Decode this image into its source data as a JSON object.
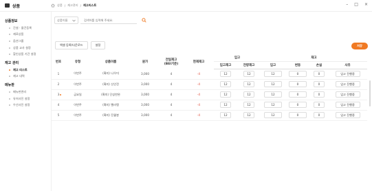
{
  "app": {
    "title": "상품"
  },
  "breadcrumb": {
    "home": "상품",
    "sep1": "/",
    "mid": "재고관리",
    "sep2": "/",
    "current": "재고리스트"
  },
  "window": {
    "minimize": "–",
    "maximize": "□",
    "close": "×"
  },
  "sidebar": {
    "sections": [
      {
        "title": "상품정보",
        "items": [
          {
            "label": "간설 · 물건등록",
            "active": false
          },
          {
            "label": "재료상품",
            "active": false
          },
          {
            "label": "옵션그룹",
            "active": false
          },
          {
            "label": "상품 교사 설정",
            "active": false
          },
          {
            "label": "할인상품 기간 설정",
            "active": false
          }
        ]
      },
      {
        "title": "재고 관리",
        "items": [
          {
            "label": "재고 리스트",
            "active": true
          },
          {
            "label": "재고 내역",
            "active": false
          }
        ]
      },
      {
        "title": "메뉴판",
        "items": [
          {
            "label": "메뉴판관리",
            "active": false
          },
          {
            "label": "유저사진 설정",
            "active": false
          },
          {
            "label": "우선사진 설정",
            "active": false
          }
        ]
      }
    ]
  },
  "search": {
    "select_value": "상품이름",
    "placeholder": "검색어를 입력해 주세요."
  },
  "toolbar": {
    "excel_label": "엑셀 등록/다운로드",
    "settings_label": "설정",
    "save_label": "저장"
  },
  "table": {
    "headers": {
      "no": "번호",
      "type": "유형",
      "name": "상품이름",
      "price": "원가",
      "prev_stock": "전일재고",
      "prev_stock_sub": "(BEI기준)",
      "current": "현재재고",
      "in_group": "입고",
      "in_qty": "입고재고",
      "in_confirm": "전량재고",
      "stock_group": "재고",
      "stock_in": "입고",
      "stock_change": "변동",
      "stock_loss": "손실",
      "reason": "사유"
    },
    "rows": [
      {
        "no": "1",
        "type": "이번주",
        "name": "(흑미) 나우미",
        "price": "3,000",
        "prev": "4",
        "current": "-4",
        "in_qty": "12",
        "in_confirm": "12",
        "s_in": "12",
        "s_change": "0",
        "s_loss": "0",
        "reason": "입고 진행중",
        "flag": false
      },
      {
        "no": "2",
        "type": "이번주",
        "name": "(흑미) 신인전",
        "price": "3,000",
        "prev": "4",
        "current": "-4",
        "in_qty": "12",
        "in_confirm": "12",
        "s_in": "12",
        "s_change": "0",
        "s_loss": "0",
        "reason": "입고 진행중",
        "flag": false
      },
      {
        "no": "3",
        "type": "금요일",
        "name": "(흑미) 단성한완",
        "price": "3,000",
        "prev": "4",
        "current": "-4",
        "in_qty": "12",
        "in_confirm": "12",
        "s_in": "12",
        "s_change": "0",
        "s_loss": "0",
        "reason": "입고 진행중",
        "flag": true
      },
      {
        "no": "4",
        "type": "이번주",
        "name": "(흑미) 빨라맹",
        "price": "3,000",
        "prev": "4",
        "current": "-4",
        "in_qty": "12",
        "in_confirm": "12",
        "s_in": "12",
        "s_change": "0",
        "s_loss": "0",
        "reason": "입고 진행중",
        "flag": false
      },
      {
        "no": "5",
        "type": "이번주",
        "name": "(흑미) 진퀄봉",
        "price": "3,000",
        "prev": "4",
        "current": "-4",
        "in_qty": "12",
        "in_confirm": "12",
        "s_in": "12",
        "s_change": "0",
        "s_loss": "0",
        "reason": "입고 진행중",
        "flag": false
      }
    ]
  },
  "pagination": {
    "prev": "‹",
    "pages": [
      "1",
      "2",
      "3",
      "4",
      "5"
    ],
    "current": "2",
    "next": "›"
  },
  "colors": {
    "accent": "#f07a24",
    "negative": "#e14b3a"
  },
  "icons": {
    "home": "home-icon",
    "search": "search-icon",
    "chevron": "chevron-down-icon",
    "logo": "store-icon"
  }
}
